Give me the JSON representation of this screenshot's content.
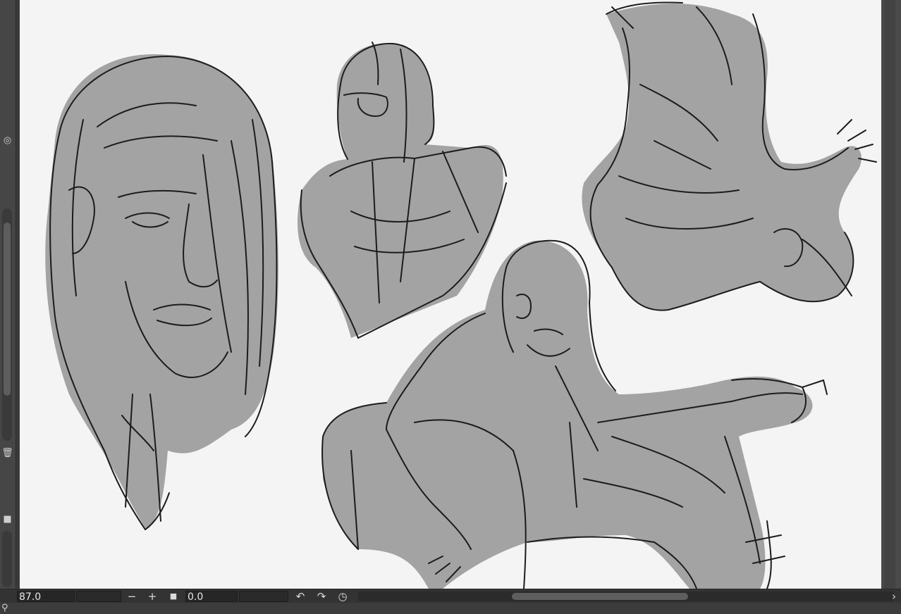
{
  "app": {
    "canvas_background": "#f4f4f4",
    "sketch_fill": "#a3a3a3",
    "ink": "#1c1c1c",
    "ui_dark": "#333333"
  },
  "left_toolbar": {
    "icons": [
      "layer-mask-icon",
      "trash-icon",
      "square-icon"
    ]
  },
  "status_bar": {
    "zoom_value": "87.0",
    "zoom_out_label": "−",
    "zoom_in_label": "+",
    "fit_label": "■",
    "rotation_value": "0.0",
    "scroll_left_label": "‹",
    "scroll_right_label": "›"
  },
  "canvas": {
    "content": "Character sketch studies: long-haired bearded man head, bust with glasses, falling pose, seated pose with bottle"
  }
}
